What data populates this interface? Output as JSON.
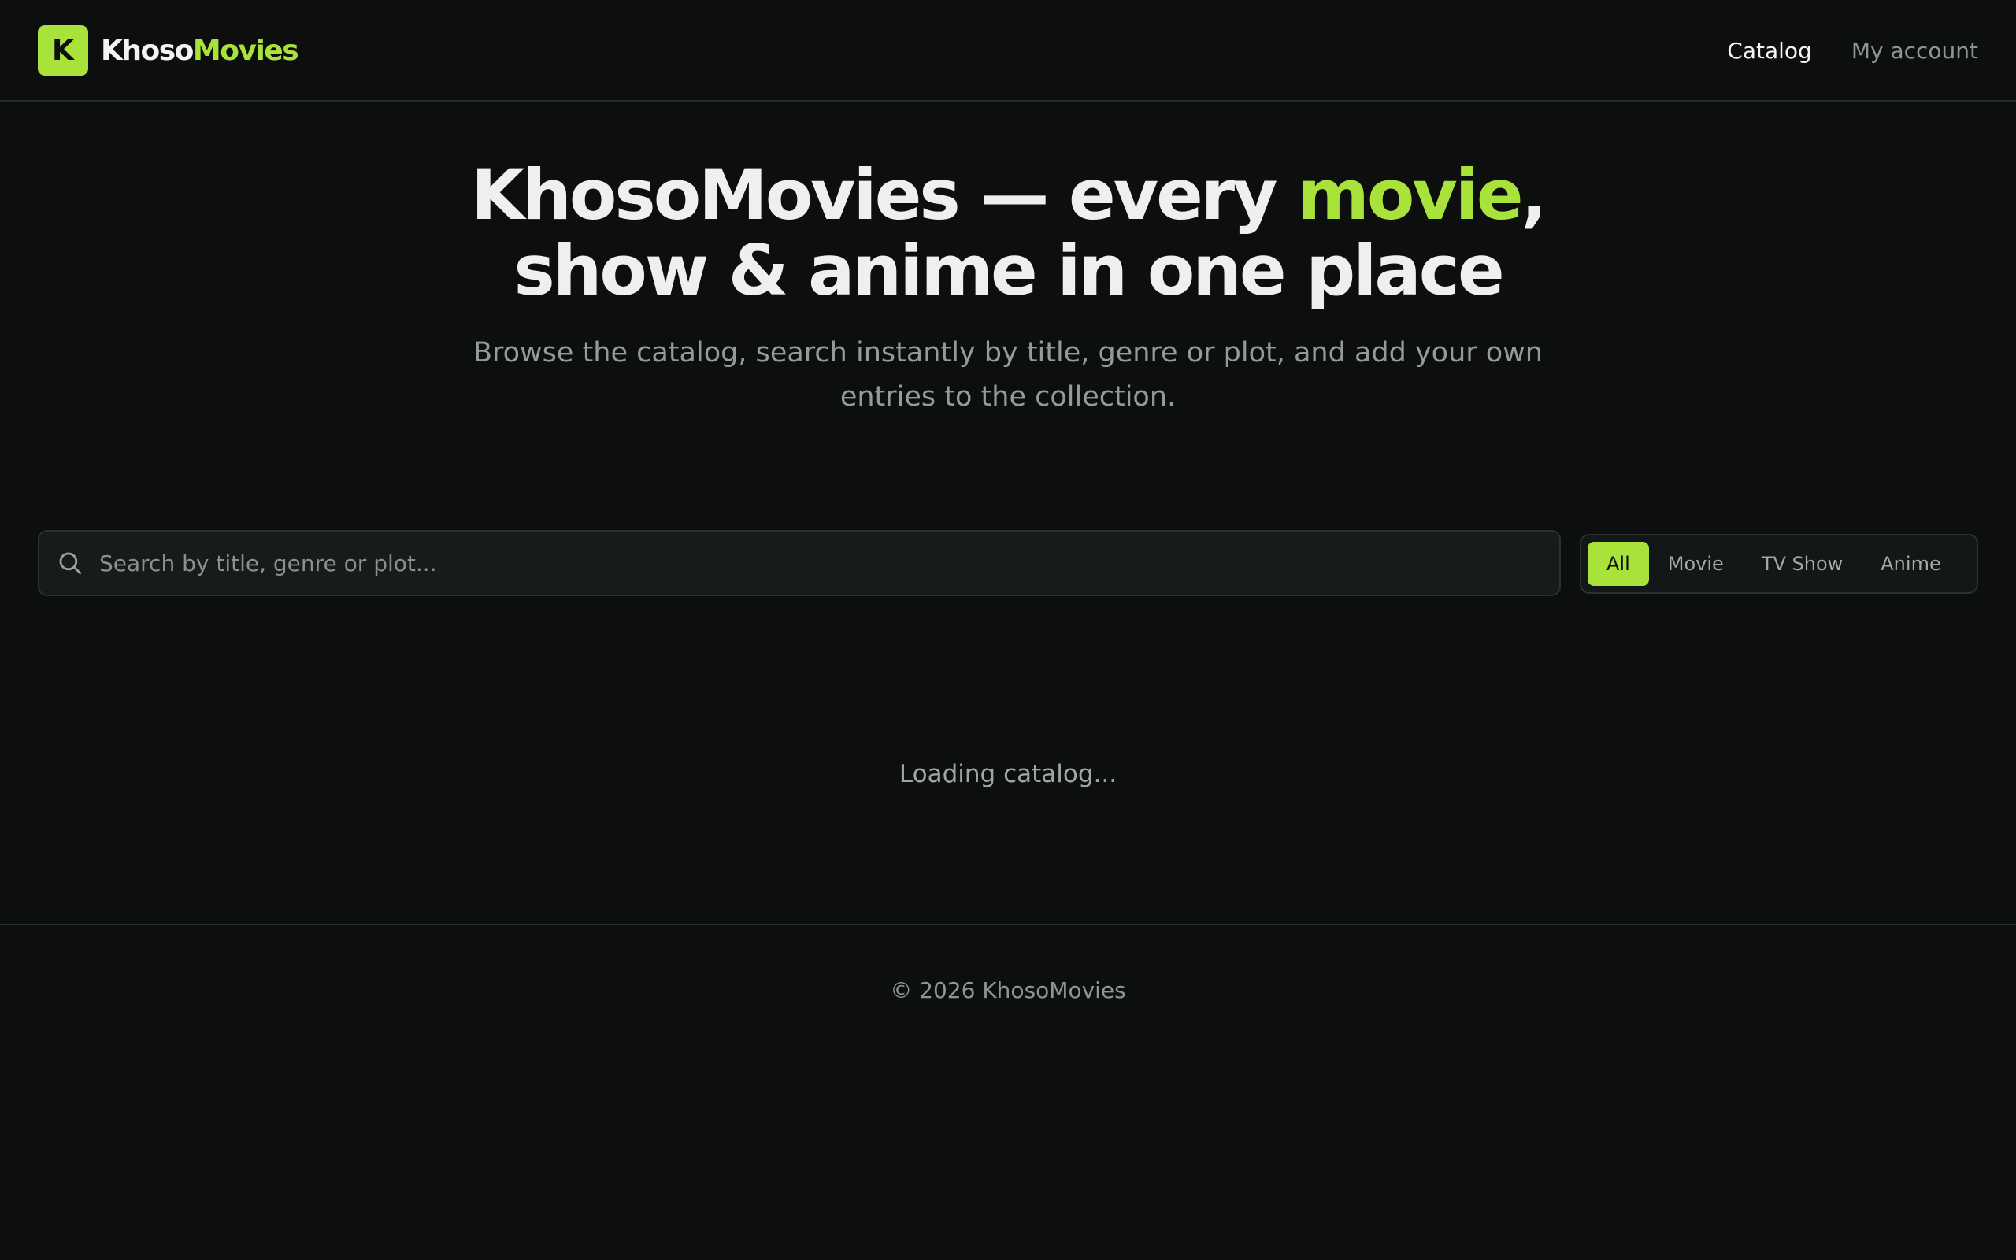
{
  "header": {
    "logo_letter": "K",
    "brand_part1": "Khoso",
    "brand_part2": "Movies",
    "nav": {
      "catalog": "Catalog",
      "account": "My account"
    }
  },
  "hero": {
    "title_line1_a": "KhosoMovies — every ",
    "title_line1_accent": "movie",
    "title_line1_b": ",",
    "title_line2": "show & anime in one place",
    "subtitle": "Browse the catalog, search instantly by title, genre or plot, and add your own entries to the collection."
  },
  "search": {
    "value": "",
    "placeholder": "Search by title, genre or plot..."
  },
  "filters": {
    "all": "All",
    "movie": "Movie",
    "tv_show": "TV Show",
    "anime": "Anime",
    "selected": "All"
  },
  "status": {
    "loading": "Loading catalog..."
  },
  "footer": {
    "copyright": "© 2026 KhosoMovies"
  },
  "colors": {
    "background": "#0d0f0f",
    "accent": "#a8e23a",
    "text": "#eef0ee",
    "muted": "#959b99"
  },
  "icons": {
    "search": "search-icon"
  }
}
